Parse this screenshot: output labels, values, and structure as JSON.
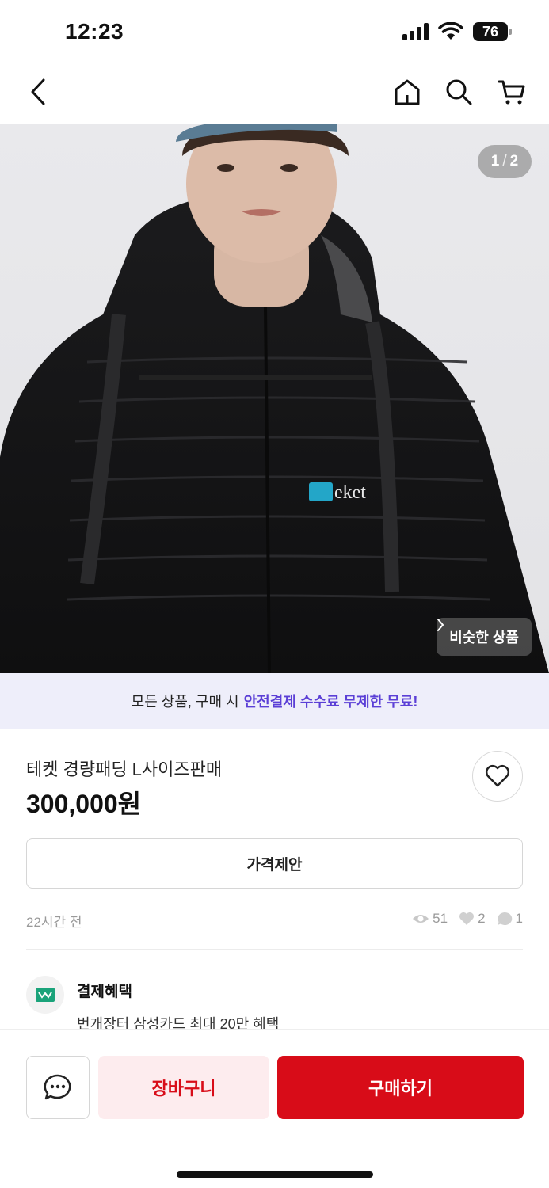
{
  "status_bar": {
    "time": "12:23",
    "battery": "76"
  },
  "nav": {
    "back_icon": "chevron-left-icon",
    "home_icon": "home-icon",
    "search_icon": "search-icon",
    "cart_icon": "cart-icon"
  },
  "gallery": {
    "current": "1",
    "separator": "/",
    "total": "2",
    "similar_label": "비슷한 상품",
    "jacket_logo_text": "eket"
  },
  "promo": {
    "text": "모든 상품, 구매 시",
    "highlight": "안전결제 수수료 무제한 무료!",
    "highlight_color": "#5b3fd6"
  },
  "product": {
    "title": "테켓 경량패딩 L사이즈판매",
    "price": "300,000원",
    "offer_label": "가격제안",
    "posted": "22시간 전",
    "views": "51",
    "likes": "2",
    "chats": "1"
  },
  "benefit": {
    "title": "결제혜택",
    "description": "번개장터 삼성카드 최대 20만 혜택"
  },
  "actions": {
    "cart_label": "장바구니",
    "buy_label": "구매하기"
  },
  "colors": {
    "brand_red": "#d80c18",
    "cart_bg": "#fdecee",
    "promo_bg": "#eeeefa",
    "benefit_green": "#1aa37a"
  }
}
